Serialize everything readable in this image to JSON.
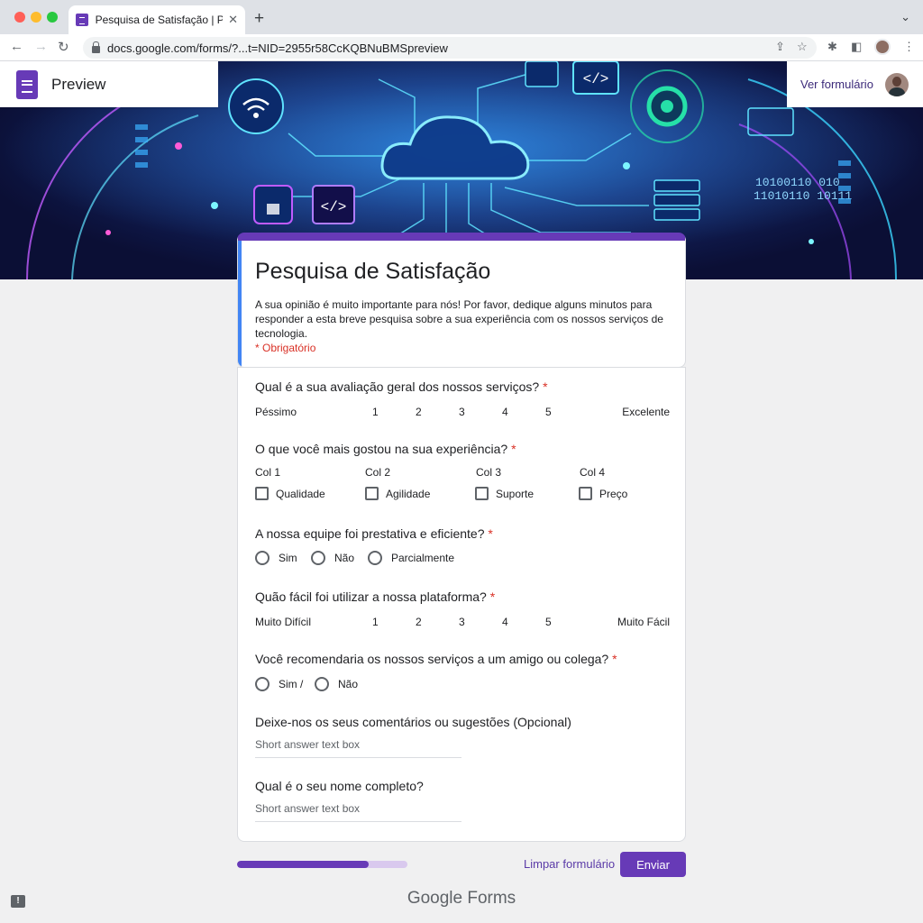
{
  "browser": {
    "tab_title": "Pesquisa de Satisfação | Previ",
    "tab_close": "✕",
    "new_tab": "+",
    "tab_menu": "⌄",
    "url": "docs.google.com/forms/?...t=NID=2955r58CcKQBNuBMSpreview",
    "back": "←",
    "forward": "→",
    "reload": "↻",
    "share_icon": "⇪",
    "bookmark_icon": "☆",
    "extensions_icon": "✱",
    "sidebar_icon": "◧",
    "menu_icon": "⋮"
  },
  "header": {
    "preview_label": "Preview",
    "view_form_link": "Ver formulário"
  },
  "banner": {
    "binary_line_1": "10100110 010",
    "binary_line_2": "11010110 10111",
    "code_glyph": "</>"
  },
  "form": {
    "title": "Pesquisa de Satisfação",
    "description": "A sua opinião é muito importante para nós! Por favor, dedique alguns minutos para responder a esta breve pesquisa sobre a sua experiência com os nossos serviços de tecnologia.",
    "required_note": "* Obrigatório"
  },
  "questions": {
    "q1": {
      "text": "Qual é a sua avaliação geral dos nossos serviços?",
      "required_mark": "*",
      "low_label": "Péssimo",
      "high_label": "Excelente",
      "scale": [
        "1",
        "2",
        "3",
        "4",
        "5"
      ]
    },
    "q2": {
      "text": "O que você mais gostou na sua experiência?",
      "required_mark": "*",
      "columns": [
        {
          "header": "Col 1",
          "option": "Qualidade"
        },
        {
          "header": "Col 2",
          "option": "Agilidade"
        },
        {
          "header": "Col 3",
          "option": "Suporte"
        },
        {
          "header": "Col 4",
          "option": "Preço"
        }
      ]
    },
    "q3": {
      "text": "A nossa equipe foi prestativa e eficiente?",
      "required_mark": "*",
      "options": [
        "Sim",
        "Não",
        "Parcialmente"
      ]
    },
    "q4": {
      "text": "Quão fácil foi utilizar a nossa plataforma?",
      "required_mark": "*",
      "low_label": "Muito Difícil",
      "high_label": "Muito Fácil",
      "scale": [
        "1",
        "2",
        "3",
        "4",
        "5"
      ]
    },
    "q5": {
      "text": "Você recomendaria os nossos serviços a um amigo ou colega?",
      "required_mark": "*",
      "options": [
        "Sim /",
        "Não"
      ]
    },
    "q6": {
      "text": "Deixe-nos os seus comentários ou sugestões (Opcional)",
      "placeholder": "Short answer text box"
    },
    "q7": {
      "text": "Qual é o seu nome completo?",
      "placeholder": "Short answer text box"
    }
  },
  "footer": {
    "progress_fraction": 0.77,
    "clear_label": "Limpar formulário",
    "submit_label": "Enviar",
    "brand": "Google Forms",
    "report_glyph": "!"
  },
  "colors": {
    "accent": "#673ab7",
    "required": "#d93025",
    "title_left_border": "#4285f4"
  }
}
